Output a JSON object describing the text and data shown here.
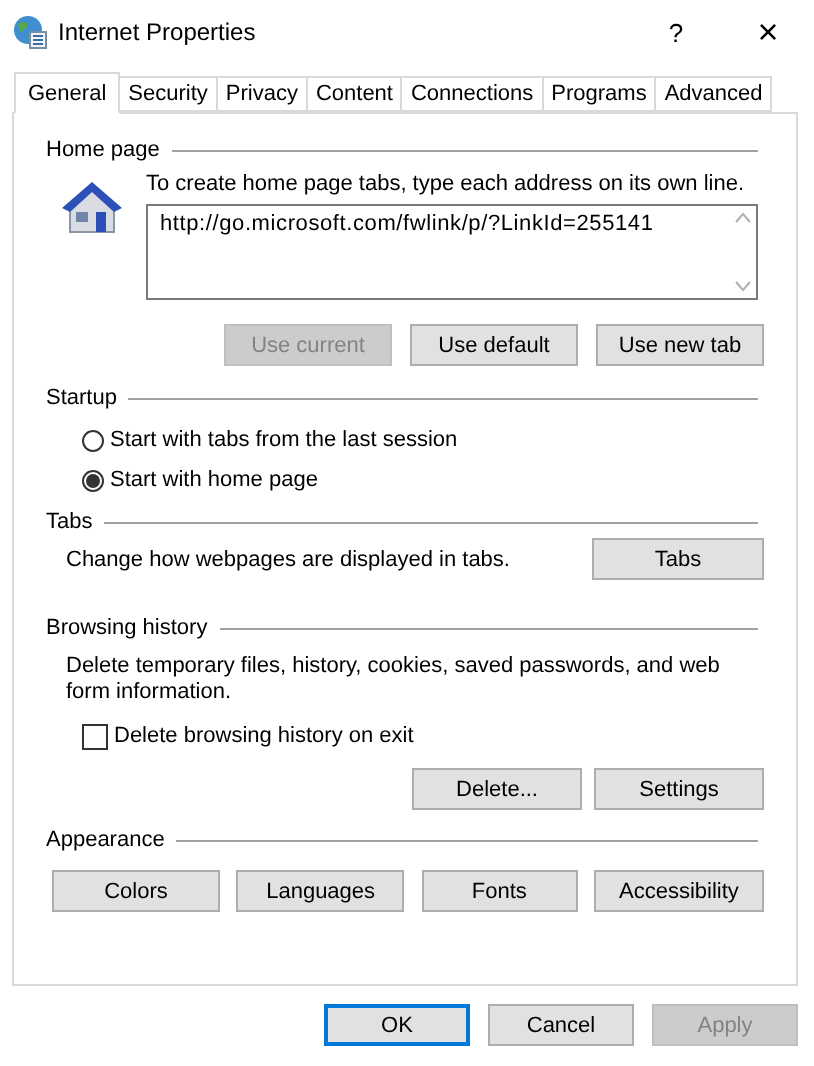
{
  "window": {
    "title": "Internet Properties",
    "help_button": "?",
    "close_button": "×"
  },
  "tabs": [
    {
      "label": "General",
      "selected": true
    },
    {
      "label": "Security",
      "selected": false
    },
    {
      "label": "Privacy",
      "selected": false
    },
    {
      "label": "Content",
      "selected": false
    },
    {
      "label": "Connections",
      "selected": false
    },
    {
      "label": "Programs",
      "selected": false
    },
    {
      "label": "Advanced",
      "selected": false
    }
  ],
  "home_page": {
    "heading": "Home page",
    "instruction": "To create home page tabs, type each address on its own line.",
    "addresses": "http://go.microsoft.com/fwlink/p/?LinkId=255141",
    "buttons": [
      {
        "label": "Use current",
        "disabled": true
      },
      {
        "label": "Use default",
        "disabled": false
      },
      {
        "label": "Use new tab",
        "disabled": false
      }
    ]
  },
  "startup": {
    "heading": "Startup",
    "options": [
      {
        "label": "Start with tabs from the last session",
        "selected": false
      },
      {
        "label": "Start with home page",
        "selected": true
      }
    ]
  },
  "tabs_section": {
    "heading": "Tabs",
    "description": "Change how webpages are displayed in tabs.",
    "button": "Tabs"
  },
  "browsing_history": {
    "heading": "Browsing history",
    "description": "Delete temporary files, history, cookies, saved passwords, and web form information.",
    "delete_on_exit": {
      "label": "Delete browsing history on exit",
      "checked": false
    },
    "buttons": [
      {
        "label": "Delete...",
        "disabled": false
      },
      {
        "label": "Settings",
        "disabled": false
      }
    ]
  },
  "appearance": {
    "heading": "Appearance",
    "buttons": [
      {
        "label": "Colors",
        "disabled": false
      },
      {
        "label": "Languages",
        "disabled": false
      },
      {
        "label": "Fonts",
        "disabled": false
      },
      {
        "label": "Accessibility",
        "disabled": false
      }
    ]
  },
  "dialog_buttons": [
    {
      "label": "OK",
      "disabled": false,
      "default": true
    },
    {
      "label": "Cancel",
      "disabled": false,
      "default": false
    },
    {
      "label": "Apply",
      "disabled": true,
      "default": false
    }
  ]
}
